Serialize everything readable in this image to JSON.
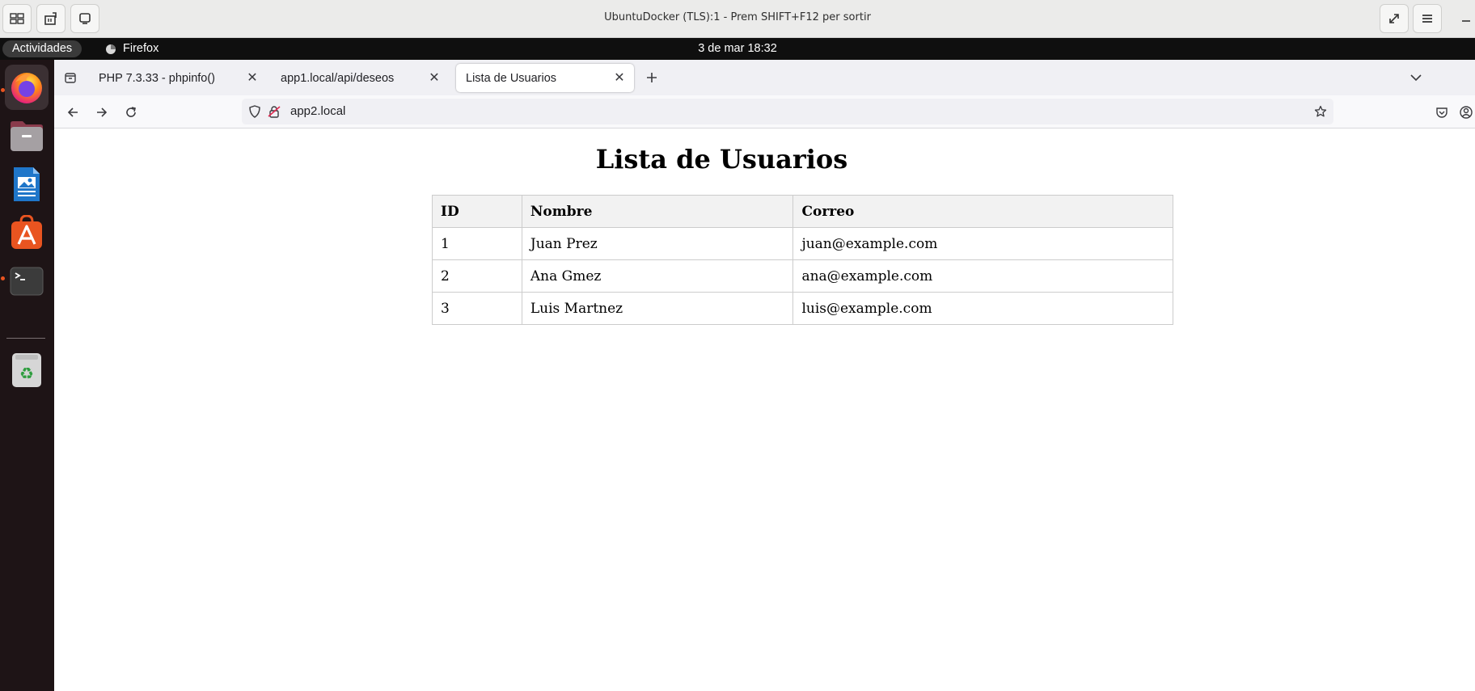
{
  "viewer": {
    "title": "UbuntuDocker (TLS):1 - Prem SHIFT+F12 per sortir"
  },
  "panel": {
    "activities": "Actividades",
    "app_name": "Firefox",
    "clock": "3 de mar  18:32"
  },
  "dock": {
    "items": [
      "firefox-icon",
      "files-icon",
      "writer-icon",
      "app-center-icon",
      "terminal-icon",
      "trash-icon"
    ]
  },
  "browser": {
    "tabs": [
      {
        "label": "PHP 7.3.33 - phpinfo()",
        "active": false
      },
      {
        "label": "app1.local/api/deseos",
        "active": false
      },
      {
        "label": "Lista de Usuarios",
        "active": true
      }
    ],
    "url": "app2.local"
  },
  "page": {
    "title": "Lista de Usuarios",
    "table": {
      "headers": [
        "ID",
        "Nombre",
        "Correo"
      ],
      "rows": [
        [
          "1",
          "Juan Prez",
          "juan@example.com"
        ],
        [
          "2",
          "Ana Gmez",
          "ana@example.com"
        ],
        [
          "3",
          "Luis Martnez",
          "luis@example.com"
        ]
      ]
    }
  },
  "colors": {
    "accent": "#e95420",
    "dock_bg": "#1e1416",
    "panel_bg": "#0f0f0f"
  }
}
